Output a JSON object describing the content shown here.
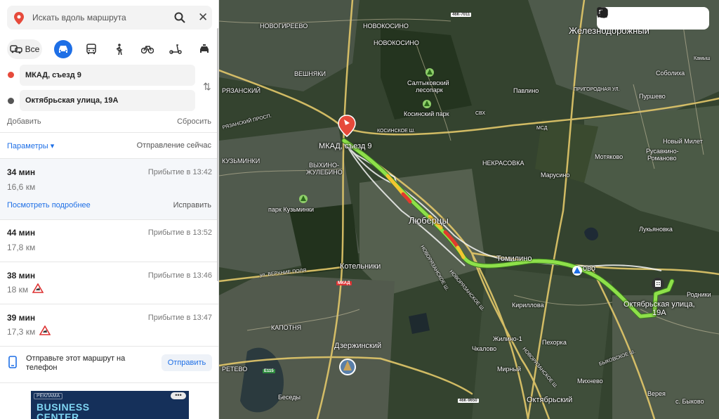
{
  "search": {
    "placeholder": "Искать вдоль маршрута"
  },
  "modes": {
    "all_label": "Все"
  },
  "route_points": {
    "from": "МКАД, съезд 9",
    "to": "Октябрьская улица, 19А"
  },
  "actions": {
    "add": "Добавить",
    "reset": "Сбросить"
  },
  "params": {
    "label": "Параметры",
    "arrow": "▾",
    "departure": "Отправление сейчас"
  },
  "routes": [
    {
      "time": "34 мин",
      "arrival": "Прибытие в 13:42",
      "distance": "16,6 км"
    },
    {
      "time": "44 мин",
      "arrival": "Прибытие в 13:52",
      "distance": "17,8 км"
    },
    {
      "time": "38 мин",
      "arrival": "Прибытие в 13:46",
      "distance": "18 км"
    },
    {
      "time": "39 мин",
      "arrival": "Прибытие в 13:47",
      "distance": "17,3 км"
    }
  ],
  "selected_route": {
    "details": "Посмотреть подробнее",
    "fix": "Исправить"
  },
  "send": {
    "text": "Отправьте этот маршрут на телефон",
    "button": "Отправить"
  },
  "ad": {
    "tag": "РЕКЛАМА",
    "line1": "BUSINESS",
    "line2": "CENTER",
    "menu": "•••"
  },
  "map": {
    "start_label": "МКАД, съезд 9",
    "end_label_1": "Октябрьская улица,",
    "end_label_2": "19А",
    "places": {
      "zheleznodorozhny": "Железнодорожный",
      "novogireevo": "НОВОГИРЕЕВО",
      "novokosino": "НОВОКОСИНО",
      "novokosino2": "НОВОКОСИНО",
      "veshnyaki": "ВЕШНЯКИ",
      "saltykovsky": "Салтыковский",
      "saltykovsky2": "лесопарк",
      "kosinsky": "Косинский парк",
      "pavlino": "Павлино",
      "soboliha": "Соболиха",
      "purshevo": "Пуршево",
      "ryazansky": "РЯЗАНСКИЙ",
      "kuzminki": "КУЗЬМИНКИ",
      "vykhino": "ВЫХИНО-",
      "zhulebino": "ЖУЛЕБИНО",
      "nekrasovka": "НЕКРАСОВКА",
      "marusino": "Марусино",
      "motyakovo": "Мотяково",
      "rusavkino": "Русавкино-",
      "romanovo": "Романово",
      "novy_milet": "Новый Милет",
      "park_kuzminki": "парк Кузьминки",
      "lyubertsy": "Люберцы",
      "lukyanovka": "Лукьяновка",
      "tomilino": "Томилино",
      "malakhovka_part": "ово",
      "kotelniki": "Котельники",
      "kirillovka": "Кириллова",
      "rodniki": "Родники",
      "kapotnya": "КАПОТНЯ",
      "dzerzhinsky": "Дзержинский",
      "zhilino": "Жилино-1",
      "pekhorka": "Пехорка",
      "chkalovo": "Чкалово",
      "mirny": "Мирный",
      "mikhnevo": "Михнево",
      "oktyabrsky": "Октябрьский",
      "beseda": "Беседы",
      "vereya": "Верея",
      "bykovo": "с. Быково",
      "kryukovo": "РЕТЕВО"
    },
    "road_signs": {
      "r1": "46К-7011",
      "r2": "46К-9650",
      "r3": "Е115",
      "mkad": "МКАД"
    },
    "street_labels": {
      "kosinskoe": "КОСИНСКОЕ Ш.",
      "svkh": "СВХ",
      "mcd": "МСД",
      "prigorodnaya": "ПРИГОРОДНАЯ УЛ.",
      "ryazansky_pr": "РЯЗАНСКИЙ ПРОСП.",
      "novoryazanskoe": "НОВОРЯЗАНСКОЕ Ш.",
      "verkhnie_polya": "ул. ВЕРХНИЕ ПОЛЯ",
      "novoryazanskoe2": "НОВОРЯЗАНСКОЕ Ш.",
      "bykovskoe": "БЫКОВСКОЕ Ш.",
      "novoryazanskoe3": "НОВОРЯЗАНСКОЕ Ш.",
      "kamyshovo": "Камыш"
    }
  },
  "colors": {
    "accent": "#1e6fe6",
    "route_green": "#8ee04a",
    "route_red": "#e23b2d",
    "route_yellow": "#f2c531",
    "start_pin": "#e64a3b"
  }
}
